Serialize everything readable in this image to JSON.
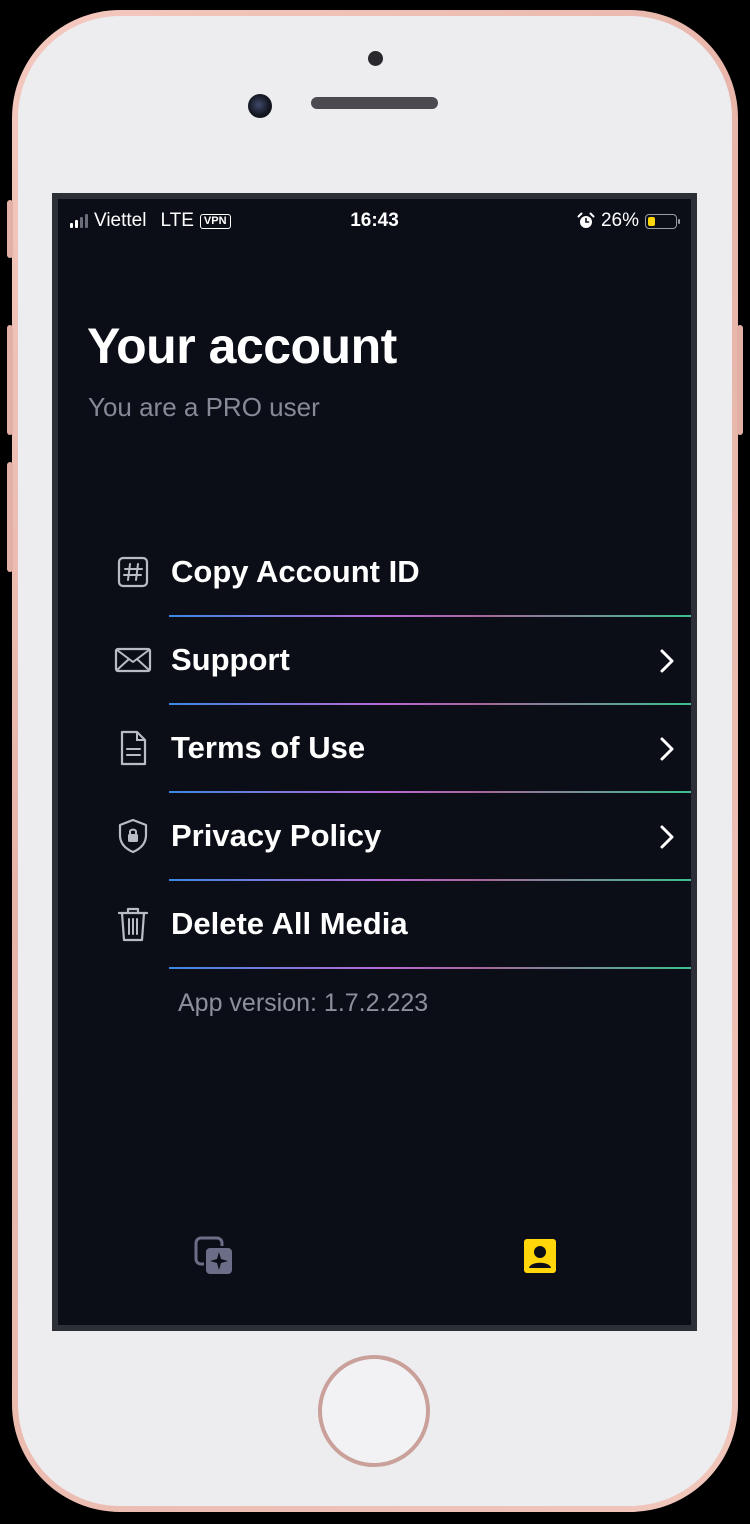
{
  "status_bar": {
    "carrier": "Viettel",
    "network": "LTE",
    "vpn": "VPN",
    "time": "16:43",
    "battery_percent": "26%",
    "battery_level": 0.26
  },
  "header": {
    "title": "Your account",
    "subtitle": "You are a PRO user"
  },
  "menu": {
    "items": [
      {
        "label": "Copy Account ID",
        "icon": "hashtag-icon",
        "chevron": false
      },
      {
        "label": "Support",
        "icon": "envelope-icon",
        "chevron": true
      },
      {
        "label": "Terms of Use",
        "icon": "document-icon",
        "chevron": true
      },
      {
        "label": "Privacy Policy",
        "icon": "shield-lock-icon",
        "chevron": true
      },
      {
        "label": "Delete All Media",
        "icon": "trash-icon",
        "chevron": false
      }
    ]
  },
  "footer": {
    "app_version": "App version: 1.7.2.223"
  },
  "tab_bar": {
    "tabs": [
      {
        "icon": "gallery-sparkle-icon",
        "active": false
      },
      {
        "icon": "account-icon",
        "active": true
      }
    ]
  },
  "colors": {
    "background": "#0b0e17",
    "active_tab": "#ffd60a",
    "inactive_tab": "#6b6e86",
    "subtitle": "#868a96"
  }
}
